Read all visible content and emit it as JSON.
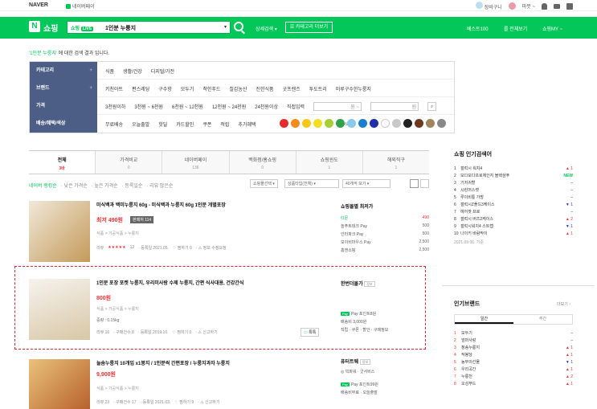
{
  "topbar": {
    "naver": "NAVER",
    "npay": "네이버페이",
    "right_items": [
      "장바구니",
      "마뭇 ~"
    ]
  },
  "header": {
    "logo": "N",
    "logo_text": "쇼핑",
    "live_label": "쇼핑",
    "live_badge": "LIVE",
    "query": "1인분 누룽지",
    "detail_search": "상세검색 ▾",
    "category_btn": "☰ 카테고리 더보기",
    "best100": "베스트100",
    "all_view": "를 전체보기",
    "my": "쇼핑MY ~"
  },
  "notice": {
    "query": "'1인분 누룽지'",
    "rest": " 에 대한 검색 결과 입니다."
  },
  "filters": [
    {
      "label": "카테고리",
      "plus": "+",
      "options": [
        "식품",
        "생활/건강",
        "디지털/가전"
      ]
    },
    {
      "label": "브랜드",
      "plus": "+",
      "options": [
        "키친아트",
        "편스레딩",
        "구수향",
        "모두기",
        "착한푸드",
        "칠갑농산",
        "진한식품",
        "굿프렌즈",
        "투도트리",
        "미루구수한누룽지"
      ]
    },
    {
      "label": "가격",
      "plus": "",
      "options": [
        "3천원이하",
        "3천원 ~ 6천원",
        "6천원 ~ 12천원",
        "12천원 ~ 24천원",
        "24천원이상",
        "직접입력",
        "원 ~",
        "원"
      ]
    },
    {
      "label": "배송/혜택/색상",
      "plus": "",
      "options": [
        "무료배송",
        "오늘출발",
        "핫딜",
        "카드할인",
        "쿠폰",
        "적립",
        "추가혜택",
        "색상"
      ]
    }
  ],
  "colors": [
    "#e52b2b",
    "#f78a1d",
    "#f6c916",
    "#f0e020",
    "#a7cf35",
    "#2fa24a",
    "#89c9ea",
    "#1a7fd1",
    "#2130a8",
    "#ffffff",
    "#c8c8c8",
    "#222222",
    "#6b3a1f",
    "#a0845c",
    "#888888"
  ],
  "tabs": [
    {
      "label": "전체",
      "count": "3바"
    },
    {
      "label": "가격비교",
      "count": "0"
    },
    {
      "label": "네이버페이",
      "count": "136"
    },
    {
      "label": "백화점/홈쇼핑",
      "count": "0"
    },
    {
      "label": "쇼핑윈도",
      "count": "1"
    },
    {
      "label": "해외직구",
      "count": "1"
    }
  ],
  "toolbar": {
    "items": [
      "네이버 랭킹순",
      "· 낮은 가격순",
      "· 높은 가격순",
      "· 등록일순",
      "· 리뷰 많은순"
    ],
    "sel1": "쇼핑몰선택 ▾",
    "sel2": "상품타입(전체) ▾",
    "sel3": "40개씩 보기 ▾"
  },
  "products": [
    {
      "title": "미식백과 백미누룽지 60g - 미식백과 누룽지 60g 1인분 개별포장",
      "price": "최저 490원",
      "tag": "판매처 114",
      "category": "식품 > 가공식품 > 누룽지",
      "info": [
        "리뷰",
        "★★★★★",
        "12",
        "· 등록일 2021.05.",
        "♡ 찜하기 0",
        "· ⚠ 정보 수정요청"
      ]
    },
    {
      "title": "1인분 포장 포켓 누룽지, 우리미사랑 수제 누룽지, 간편 식사대용, 건강간식",
      "price": "800원",
      "tag": "",
      "category": "식품 > 가공식품 > 누룽지",
      "extra": "중량 : 0.15kg",
      "info": [
        "리뷰 16",
        "· 구매건수 8",
        "· 등록일 2019.10.",
        "♡ 찜하기 0",
        "· ⚠ 신고하기"
      ],
      "talk": "톡톡"
    },
    {
      "title": "늘솜누룽지 10개입 x1봉지 / 1인분씩 간편포장 / 누룽지과자 누룽지",
      "price": "9,900원",
      "tag": "",
      "category": "식품 > 가공식품 > 누룽지",
      "info": [
        "리뷰 23",
        "· 구매건수 17",
        "· 등록일 2021.03.",
        "♡ 찜하기 9",
        "· ⚠ 신고하기"
      ]
    }
  ],
  "sides": [
    {
      "head": "쇼핑몰별 최저가",
      "rows": [
        [
          "티몬",
          "490"
        ],
        [
          "놀푸트데크 Pay",
          "500"
        ],
        [
          "인터파크 Pay",
          "500"
        ],
        [
          "모이비마우스 Pay",
          "2,500"
        ],
        [
          "홈앤쇼핑",
          "2,500"
        ]
      ]
    },
    {
      "head": "한번더몰가",
      "badge": "정보",
      "rows": [
        [
          "Pay 포인트8원",
          ""
        ],
        [
          "배송비 3,000원",
          ""
        ],
        [
          "직립 · 쿠폰 · 할인 · 구매정보",
          ""
        ]
      ]
    },
    {
      "head": "퓨터트웨",
      "badge": "정보",
      "rows": [
        [
          "◎ 빅파워 · 굿서비스",
          ""
        ],
        [
          "Pay 포인트99원",
          ""
        ],
        [
          "배송비무료 · 오늘출발",
          ""
        ]
      ]
    }
  ],
  "ranking": {
    "head": "쇼핑 인기검색어",
    "items": [
      {
        "n": "1",
        "t": "갤럭시 워치4",
        "ch": "▲ 1",
        "cls": "up"
      },
      {
        "n": "2",
        "t": "모다모다프로체인지 블랙샴푸",
        "ch": "NEW",
        "cls": "new"
      },
      {
        "n": "3",
        "t": "기저귀할",
        "ch": "–",
        "cls": ""
      },
      {
        "n": "4",
        "t": "시린머스켓",
        "ch": "–",
        "cls": ""
      },
      {
        "n": "5",
        "t": "루이비통 가방",
        "ch": "–",
        "cls": ""
      },
      {
        "n": "6",
        "t": "갤럭시Z폴드3케이스",
        "ch": "▼ 1",
        "cls": "dn"
      },
      {
        "n": "7",
        "t": "에어팟 프로",
        "ch": "–",
        "cls": ""
      },
      {
        "n": "8",
        "t": "갤럭시 버즈2케이스",
        "ch": "▲ 2",
        "cls": "up"
      },
      {
        "n": "9",
        "t": "갤럭시워치4 스트랩",
        "ch": "▼ 1",
        "cls": "dn"
      },
      {
        "n": "10",
        "t": "나이키 바람막이",
        "ch": "▲ 1",
        "cls": "up"
      }
    ],
    "date": "2021.09.06. 기준"
  },
  "brands": {
    "head": "인기브랜드",
    "more": "더보기 ›",
    "tabs": [
      "일간",
      "주간"
    ],
    "items": [
      {
        "n": "1",
        "t": "모두기",
        "ch": "–",
        "cls": ""
      },
      {
        "n": "2",
        "t": "엄마사랑",
        "ch": "–",
        "cls": ""
      },
      {
        "n": "3",
        "t": "청송누룽지",
        "ch": "▲ 1",
        "cls": "up"
      },
      {
        "n": "4",
        "t": "작봉당",
        "ch": "▲ 1",
        "cls": "up"
      },
      {
        "n": "5",
        "t": "농부의선물",
        "ch": "▼ 1",
        "cls": "dn"
      },
      {
        "n": "6",
        "t": "우리곡간",
        "ch": "▲ 1",
        "cls": "up"
      },
      {
        "n": "7",
        "t": "누룽천",
        "ch": "▲ 2",
        "cls": "up"
      },
      {
        "n": "8",
        "t": "오성푸드",
        "ch": "▲ 1",
        "cls": "up"
      }
    ]
  }
}
